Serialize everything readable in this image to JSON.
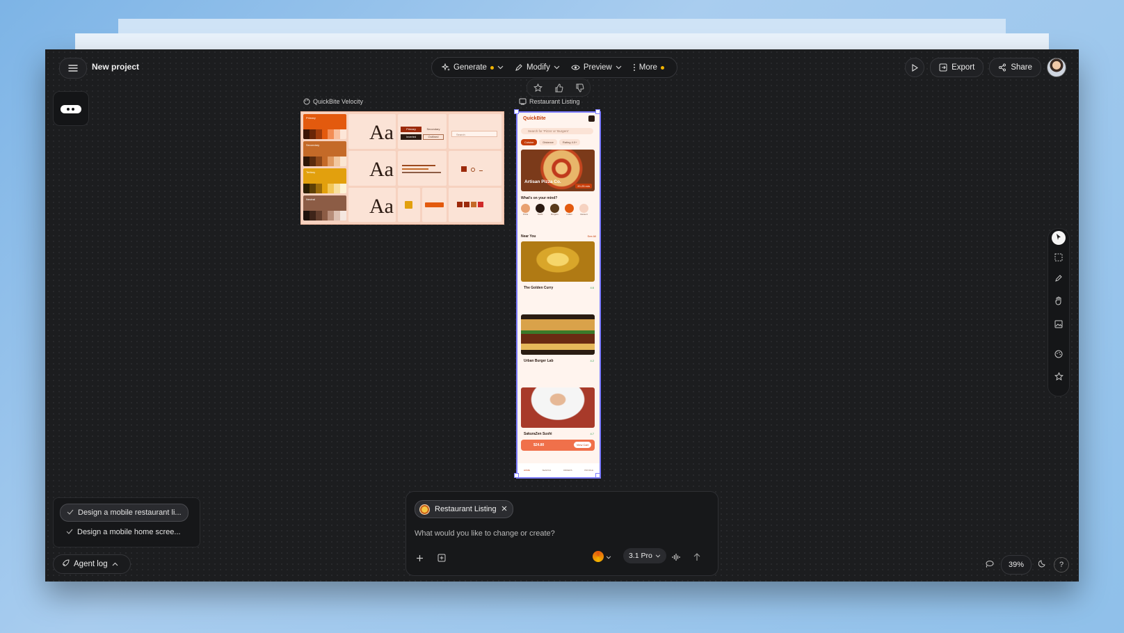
{
  "header": {
    "project_title": "New project",
    "toolbar": [
      {
        "label": "Generate",
        "icon": "sparkle-icon",
        "has_dot": true
      },
      {
        "label": "Modify",
        "icon": "pencil-icon",
        "has_dot": false
      },
      {
        "label": "Preview",
        "icon": "eye-icon",
        "has_dot": false
      },
      {
        "label": "More",
        "icon": "kebab-icon",
        "has_dot": true
      }
    ],
    "export_label": "Export",
    "share_label": "Share"
  },
  "canvas": {
    "design_system_frame": {
      "label": "QuickBite Velocity",
      "aa": "Aa",
      "swatches": [
        {
          "name": "Primary",
          "color": "#e35a0e"
        },
        {
          "name": "Secondary",
          "color": "#c46a28"
        },
        {
          "name": "Tertiary",
          "color": "#e2a00d"
        },
        {
          "name": "Neutral",
          "color": "#8c5c45"
        }
      ],
      "btn_primary": "Primary",
      "btn_secondary": "Secondary",
      "btn_inverted": "Inverted",
      "btn_outlined": "Outlined",
      "search_placeholder": "Search"
    },
    "phone_frame": {
      "label": "Restaurant Listing",
      "app_name": "QuickBite",
      "search_placeholder": "Search for 'Pizza' or 'Burgers'",
      "filters": [
        "Cuisine",
        "Distance",
        "Rating 4.0+"
      ],
      "hero_title": "Artisan Pizza Co.",
      "hero_time": "20-25 min",
      "section_mind": "What's on your mind?",
      "categories": [
        "Pizza",
        "Sushi",
        "Burgers",
        "Indian",
        "Dessert"
      ],
      "section_near": "Near You",
      "see_all": "See All",
      "restaurants": [
        {
          "name": "The Golden Curry",
          "rating": "4.6"
        },
        {
          "name": "Urban Burger Lab",
          "rating": "4.2"
        },
        {
          "name": "SakuraZen Sushi",
          "rating": "4.7"
        }
      ],
      "cart_price": "$24.80",
      "cart_button": "View Cart",
      "nav": [
        "HOME",
        "SEARCH",
        "ORDERS",
        "PROFILE"
      ]
    }
  },
  "tasks": [
    {
      "label": "Design a mobile restaurant li...",
      "active": true
    },
    {
      "label": "Design a mobile home scree...",
      "active": false
    }
  ],
  "agent_log_label": "Agent log",
  "composer": {
    "chip_label": "Restaurant Listing",
    "placeholder": "What would you like to change or create?",
    "model_label": "3.1 Pro"
  },
  "zoom_level": "39%"
}
